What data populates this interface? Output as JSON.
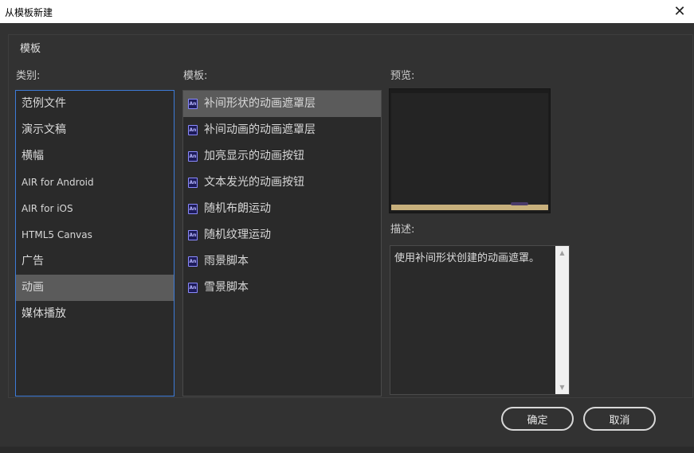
{
  "window": {
    "title": "从模板新建",
    "close_glyph": "✕"
  },
  "group_label": "模板",
  "categories": {
    "label": "类别:",
    "items": [
      {
        "label": "范例文件",
        "selected": false,
        "small": false
      },
      {
        "label": "演示文稿",
        "selected": false,
        "small": false
      },
      {
        "label": "横幅",
        "selected": false,
        "small": false
      },
      {
        "label": "AIR for Android",
        "selected": false,
        "small": true
      },
      {
        "label": "AIR for iOS",
        "selected": false,
        "small": true
      },
      {
        "label": "HTML5 Canvas",
        "selected": false,
        "small": true
      },
      {
        "label": "广告",
        "selected": false,
        "small": false
      },
      {
        "label": "动画",
        "selected": true,
        "small": false
      },
      {
        "label": "媒体播放",
        "selected": false,
        "small": false
      }
    ]
  },
  "templates": {
    "label": "模板:",
    "icon_text": "An",
    "items": [
      {
        "label": "补间形状的动画遮罩层",
        "selected": true
      },
      {
        "label": "补间动画的动画遮罩层",
        "selected": false
      },
      {
        "label": "加亮显示的动画按钮",
        "selected": false
      },
      {
        "label": "文本发光的动画按钮",
        "selected": false
      },
      {
        "label": "随机布朗运动",
        "selected": false
      },
      {
        "label": "随机纹理运动",
        "selected": false
      },
      {
        "label": "雨景脚本",
        "selected": false
      },
      {
        "label": "雪景脚本",
        "selected": false
      }
    ]
  },
  "preview": {
    "label": "预览:"
  },
  "description": {
    "label": "描述:",
    "text": "使用补间形状创建的动画遮罩。"
  },
  "buttons": {
    "ok": "确定",
    "cancel": "取消"
  }
}
